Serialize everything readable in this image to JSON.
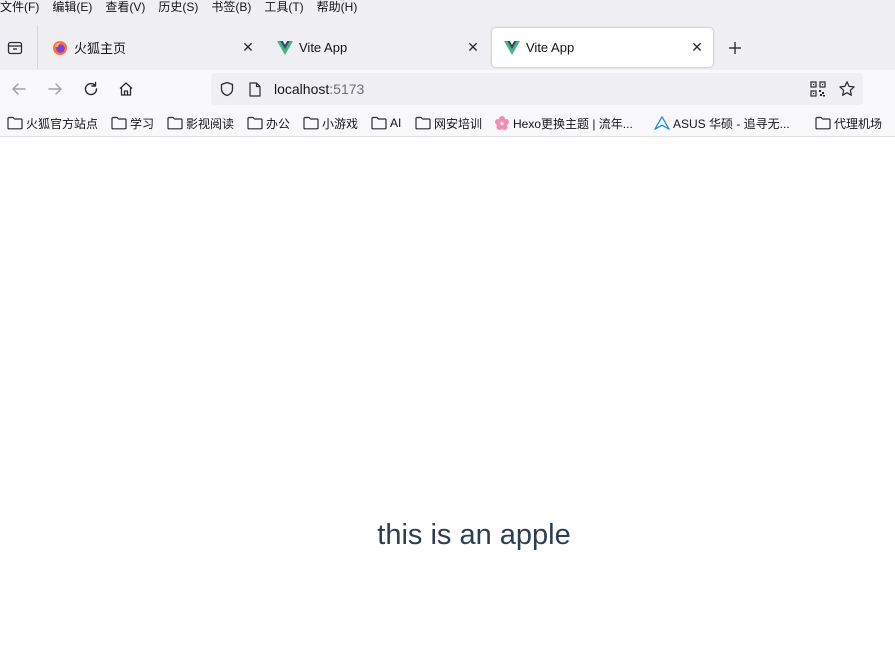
{
  "menubar": {
    "items": [
      "文件(F)",
      "编辑(E)",
      "查看(V)",
      "历史(S)",
      "书签(B)",
      "工具(T)",
      "帮助(H)"
    ]
  },
  "tabs": [
    {
      "title": "火狐主页",
      "icon": "firefox-icon",
      "selected": false
    },
    {
      "title": "Vite App",
      "icon": "vue-icon",
      "selected": false
    },
    {
      "title": "Vite App",
      "icon": "vue-icon",
      "selected": true
    }
  ],
  "urlbar": {
    "host": "localhost",
    "port": ":5173"
  },
  "bookmarks": [
    {
      "label": "火狐官方站点",
      "icon": "folder-icon"
    },
    {
      "label": "学习",
      "icon": "folder-icon"
    },
    {
      "label": "影视阅读",
      "icon": "folder-icon"
    },
    {
      "label": "办公",
      "icon": "folder-icon"
    },
    {
      "label": "小游戏",
      "icon": "folder-icon"
    },
    {
      "label": "AI",
      "icon": "folder-icon"
    },
    {
      "label": "网安培训",
      "icon": "folder-icon"
    },
    {
      "label": "Hexo更换主题 | 流年...",
      "icon": "sakura-icon"
    },
    {
      "label": "ASUS 华硕 - 追寻无...",
      "icon": "asus-icon"
    },
    {
      "label": "代理机场",
      "icon": "folder-icon"
    }
  ],
  "page": {
    "text": "this is an apple",
    "text_color": "#2c3e50"
  },
  "colors": {
    "chrome_bg": "#f0f0f4",
    "toolbar_bg": "#f9f9fb",
    "vue_green": "#41b883",
    "vue_dark": "#35495e"
  }
}
